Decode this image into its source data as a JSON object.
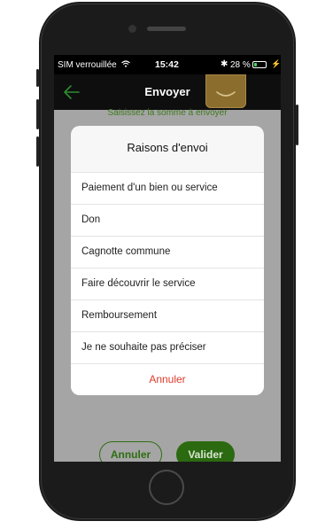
{
  "status": {
    "carrier": "SIM verrouillée",
    "time": "15:42",
    "battery": "28 %",
    "battery_level": 0.28,
    "battery_color": "#4cd964"
  },
  "header": {
    "title": "Envoyer",
    "back_icon": "arrow-left-icon"
  },
  "main": {
    "prompt": "Saisissez la somme à envoyer",
    "cancel_label": "Annuler",
    "validate_label": "Valider"
  },
  "modal": {
    "title": "Raisons d'envoi",
    "options": [
      {
        "label": "Paiement d'un bien ou service"
      },
      {
        "label": "Don"
      },
      {
        "label": "Cagnotte commune"
      },
      {
        "label": "Faire découvrir le service"
      },
      {
        "label": "Remboursement"
      },
      {
        "label": "Je ne souhaite pas préciser"
      }
    ],
    "cancel_label": "Annuler",
    "cancel_color": "#e03a2b"
  },
  "colors": {
    "accent_green": "#2b6a10"
  }
}
